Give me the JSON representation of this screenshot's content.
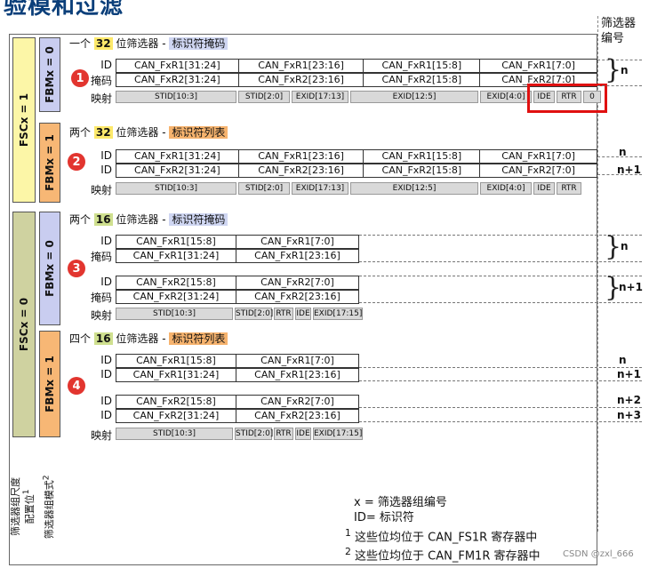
{
  "heading": "验模和过滤",
  "filter_number_header": [
    "筛选器",
    "编号"
  ],
  "fscx_1": "FSCx = 1",
  "fscx_0": "FSCx = 0",
  "fbmx_0": "FBMx = 0",
  "fbmx_1": "FBMx = 1",
  "bottom_label_scale": [
    "筛选器组尺度",
    "配置位"
  ],
  "bottom_label_scale_sup": "1",
  "bottom_label_mode": "筛选器组模式",
  "bottom_label_mode_sup": "2",
  "sections": [
    {
      "badge": "1",
      "pre": "一个",
      "num": "32",
      "mid": "位筛选器 - ",
      "tag": "标识符掩码"
    },
    {
      "badge": "2",
      "pre": "两个",
      "num": "32",
      "mid": "位筛选器 - ",
      "tag": "标识符列表"
    },
    {
      "badge": "3",
      "pre": "两个",
      "num": "16",
      "mid": "位筛选器 - ",
      "tag": "标识符掩码"
    },
    {
      "badge": "4",
      "pre": "四个",
      "num": "16",
      "mid": "位筛选器 - ",
      "tag": "标识符列表"
    }
  ],
  "labels": {
    "id": "ID",
    "mask": "掩码",
    "map": "映射"
  },
  "s1": {
    "row1": [
      "CAN_FxR1[31:24]",
      "CAN_FxR1[23:16]",
      "CAN_FxR1[15:8]",
      "CAN_FxR1[7:0]"
    ],
    "row2": [
      "CAN_FxR2[31:24]",
      "CAN_FxR2[23:16]",
      "CAN_FxR2[15:8]",
      "CAN_FxR2[7:0]"
    ],
    "map": [
      "STID[10:3]",
      "STID[2:0]",
      "EXID[17:13]",
      "EXID[12:5]",
      "EXID[4:0]",
      "IDE",
      "RTR",
      "0"
    ]
  },
  "s2": {
    "row1": [
      "CAN_FxR1[31:24]",
      "CAN_FxR1[23:16]",
      "CAN_FxR1[15:8]",
      "CAN_FxR1[7:0]"
    ],
    "row2": [
      "CAN_FxR2[31:24]",
      "CAN_FxR2[23:16]",
      "CAN_FxR2[15:8]",
      "CAN_FxR2[7:0]"
    ],
    "map": [
      "STID[10:3]",
      "STID[2:0]",
      "EXID[17:13]",
      "EXID[12:5]",
      "EXID[4:0]",
      "IDE",
      "RTR"
    ]
  },
  "s3": {
    "a1": [
      "CAN_FxR1[15:8]",
      "CAN_FxR1[7:0]"
    ],
    "a2": [
      "CAN_FxR1[31:24]",
      "CAN_FxR1[23:16]"
    ],
    "b1": [
      "CAN_FxR2[15:8]",
      "CAN_FxR2[7:0]"
    ],
    "b2": [
      "CAN_FxR2[31:24]",
      "CAN_FxR2[23:16]"
    ],
    "map": [
      "STID[10:3]",
      "STID[2:0]",
      "RTR",
      "IDE",
      "EXID[17:15]"
    ]
  },
  "s4": {
    "a1": [
      "CAN_FxR1[15:8]",
      "CAN_FxR1[7:0]"
    ],
    "a2": [
      "CAN_FxR1[31:24]",
      "CAN_FxR1[23:16]"
    ],
    "b1": [
      "CAN_FxR2[15:8]",
      "CAN_FxR2[7:0]"
    ],
    "b2": [
      "CAN_FxR2[31:24]",
      "CAN_FxR2[23:16]"
    ],
    "map": [
      "STID[10:3]",
      "STID[2:0]",
      "RTR",
      "IDE",
      "EXID[17:15]"
    ]
  },
  "filter_numbers": {
    "n": "n",
    "n1": "n+1",
    "n2": "n+2",
    "n3": "n+3"
  },
  "notes": {
    "x_def": "x = 筛选器组编号",
    "id_def": "ID= 标识符",
    "fn1_sup": "1",
    "fn1": " 这些位均位于 CAN_FS1R 寄存器中",
    "fn2_sup": "2",
    "fn2": " 这些位均位于 CAN_FM1R 寄存器中"
  },
  "watermark": "CSDN @zxl_666",
  "colors": {
    "fsc1": "#fcf6a7",
    "fsc0": "#cfd2a0",
    "fbm0": "#c9cdf0",
    "fbm1": "#f7b775",
    "badge": "#e2352f",
    "highlight_box": "#e01010"
  }
}
